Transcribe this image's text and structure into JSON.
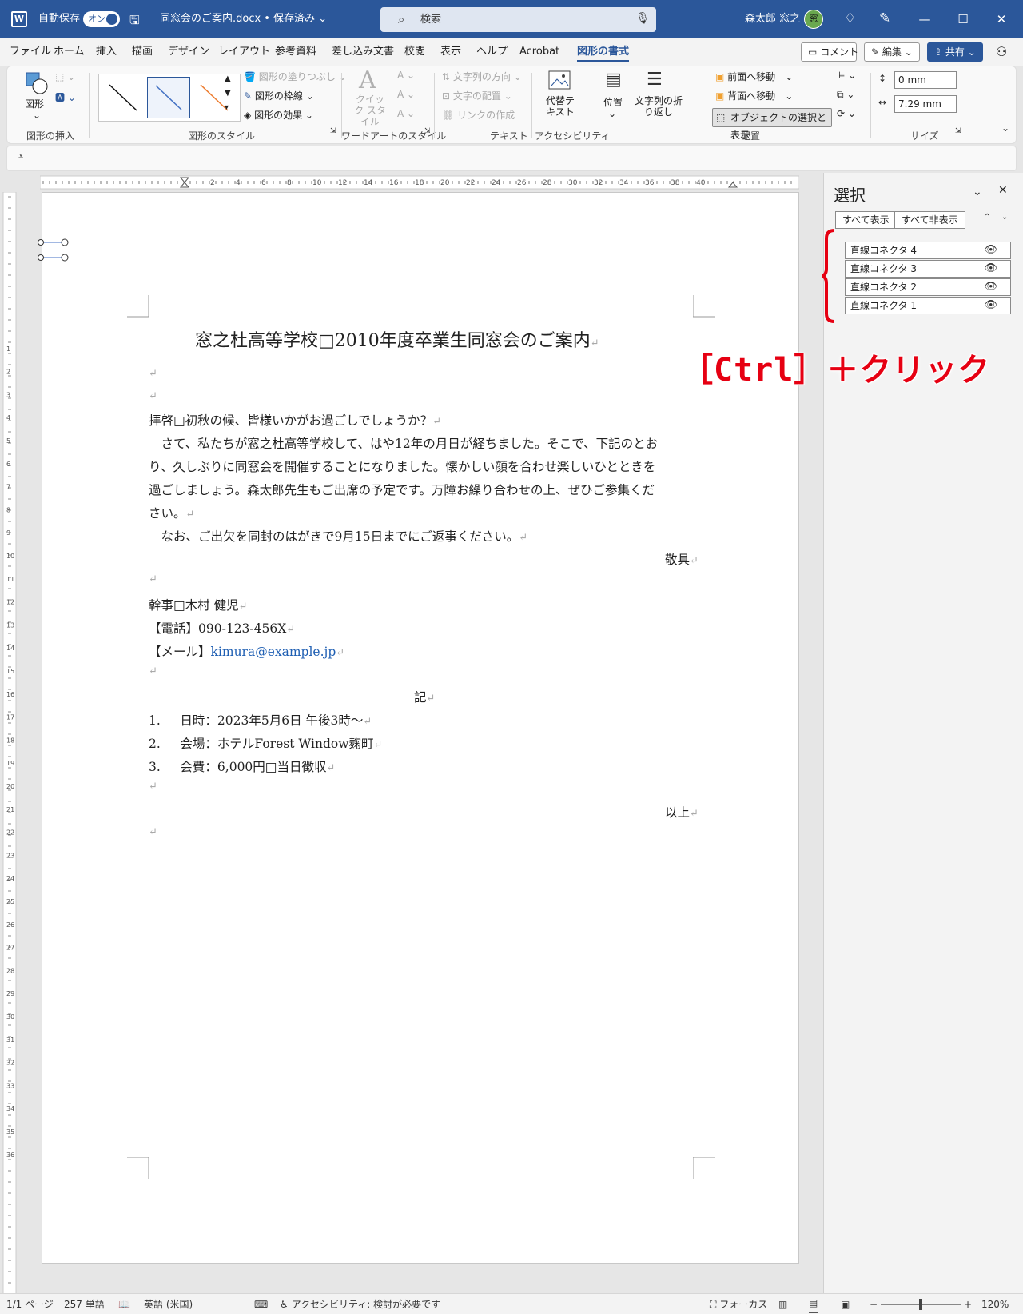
{
  "titlebar": {
    "autosave_label": "自動保存",
    "autosave_state": "オン",
    "doc_title": "同窓会のご案内.docx • 保存済み",
    "search_placeholder": "検索",
    "user_name": "森太郎 窓之",
    "avatar_text": "窓"
  },
  "menu": {
    "tabs": [
      "ファイル",
      "ホーム",
      "挿入",
      "描画",
      "デザイン",
      "レイアウト",
      "参考資料",
      "差し込み文書",
      "校閲",
      "表示",
      "ヘルプ",
      "Acrobat",
      "図形の書式"
    ],
    "comment_label": "コメント",
    "edit_label": "編集",
    "share_label": "共有"
  },
  "ribbon": {
    "shape_label": "図形",
    "group_insert": "図形の挿入",
    "group_styles": "図形のスタイル",
    "fill": "図形の塗りつぶし",
    "outline": "図形の枠線",
    "effects": "図形の効果",
    "quick_style": "クイック スタイル",
    "group_wordart": "ワードアートのスタイル",
    "text_direction": "文字列の方向",
    "text_align": "文字の配置",
    "create_link": "リンクの作成",
    "group_text": "テキスト",
    "alt_text": "代替テキスト",
    "group_accessibility": "アクセシビリティ",
    "position": "位置",
    "wrap_text": "文字列の折り返し",
    "bring_forward": "前面へ移動",
    "send_backward": "背面へ移動",
    "selection_pane": "オブジェクトの選択と表示",
    "group_arrange": "配置",
    "height_value": "0 mm",
    "width_value": "7.29 mm",
    "group_size": "サイズ"
  },
  "document": {
    "title": "窓之杜高等学校□2010年度卒業生同窓会のご案内",
    "greeting": "拝啓□初秋の候、皆様いかがお過ごしでしょうか？",
    "body1": "　さて、私たちが窓之杜高等学校して、はや12年の月日が経ちました。そこで、下記のとお",
    "body2": "り、久しぶりに同窓会を開催することになりました。懐かしい顔を合わせ楽しいひとときを",
    "body3": "過ごしましょう。森太郎先生もご出席の予定です。万障お繰り合わせの上、ぜひご参集くだ",
    "body4": "さい。",
    "body5": "　なお、ご出欠を同封のはがきで9月15日までにご返事ください。",
    "closing": "敬具",
    "organizer": "幹事□木村 健児",
    "phone": "【電話】090-123-456X",
    "mail_label": "【メール】",
    "mail": "kimura@example.jp",
    "ki": "記",
    "item1": "1.\t日時：2023年5月6日 午後3時～",
    "item2": "2.\t会場：ホテルForest Window麹町",
    "item3": "3.\t会費：6,000円□当日徴収",
    "end": "以上",
    "para_mark": "↵"
  },
  "selection_pane": {
    "title": "選択",
    "show_all": "すべて表示",
    "hide_all": "すべて非表示",
    "items": [
      "直線コネクタ 4",
      "直線コネクタ 3",
      "直線コネクタ 2",
      "直線コネクタ 1"
    ]
  },
  "annotation": "［Ctrl］＋クリック",
  "statusbar": {
    "page": "1/1 ページ",
    "words": "257 単語",
    "language": "英語 (米国)",
    "accessibility": "アクセシビリティ: 検討が必要です",
    "focus": "フォーカス",
    "zoom": "120%"
  },
  "colors": {
    "brand": "#2b579a",
    "annotation": "#e60012",
    "link": "#1f5fb3"
  }
}
